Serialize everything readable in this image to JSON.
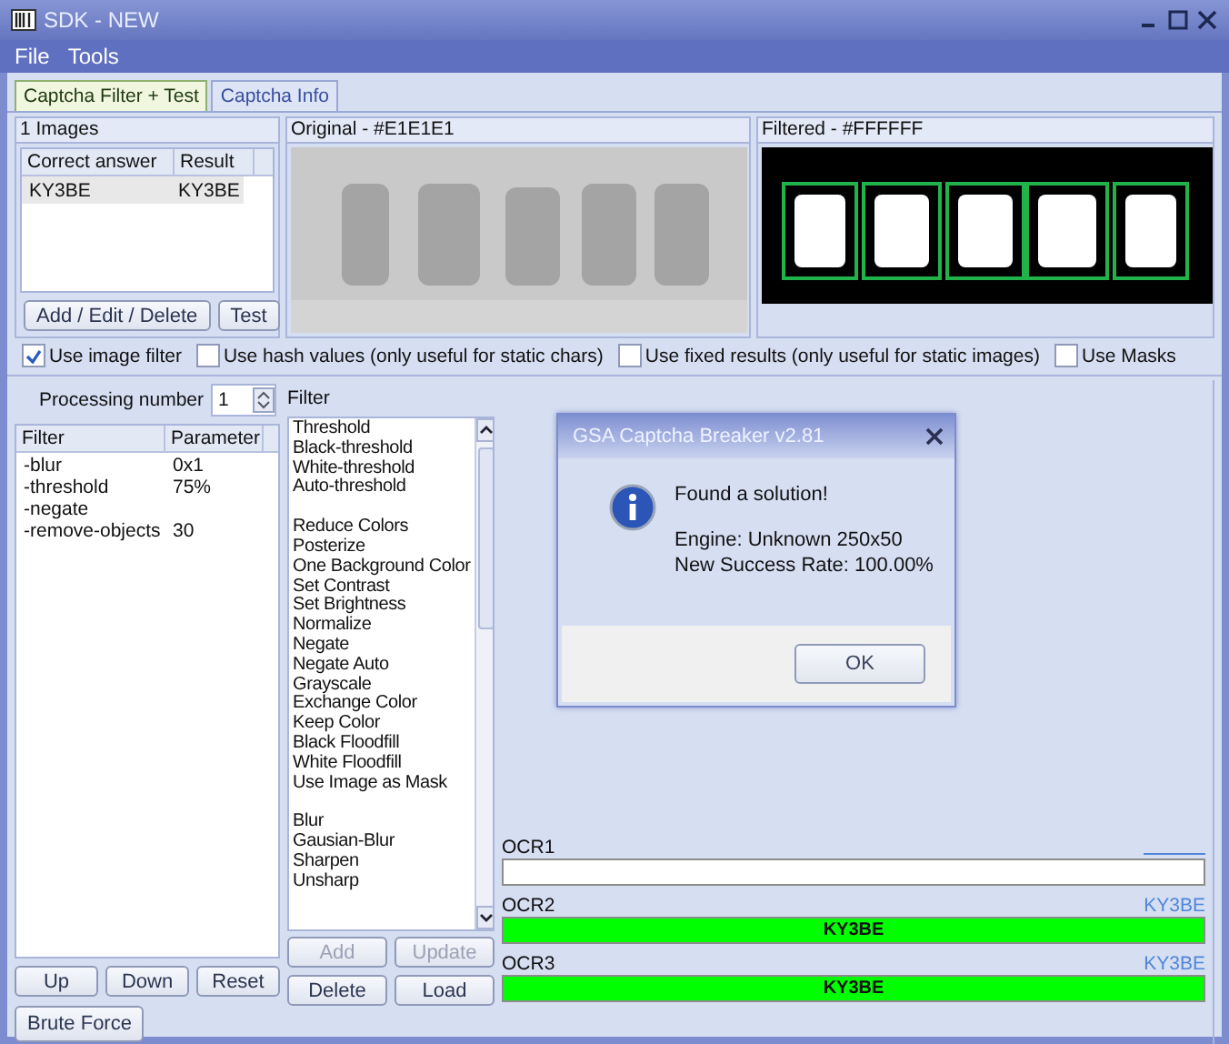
{
  "window": {
    "title": "SDK - NEW"
  },
  "menu": [
    "File",
    "Tools"
  ],
  "tabs": [
    {
      "label": "Captcha Filter + Test",
      "selected": true
    },
    {
      "label": "Captcha Info",
      "selected": false
    }
  ],
  "images_panel": {
    "title": "1 Images",
    "columns": [
      "Correct answer",
      "Result"
    ],
    "rows": [
      {
        "cells": [
          "KY3BE",
          "KY3BE"
        ],
        "selected": true
      }
    ],
    "buttons": [
      {
        "label": "Add / Edit / Delete",
        "disabled": false
      },
      {
        "label": "Test",
        "disabled": false
      }
    ]
  },
  "original": {
    "title": "Original - #E1E1E1"
  },
  "filtered": {
    "title": "Filtered - #FFFFFF"
  },
  "options": [
    {
      "label": "Use image filter",
      "checked": true
    },
    {
      "label": "Use hash values (only useful for static chars)",
      "checked": false
    },
    {
      "label": "Use fixed results (only useful for static images)",
      "checked": false
    },
    {
      "label": "Use Masks",
      "checked": false
    }
  ],
  "processing": {
    "label": "Processing number",
    "value": "1"
  },
  "filter_table": {
    "columns": [
      "Filter",
      "Parameter"
    ],
    "rows": [
      [
        "-blur",
        "0x1"
      ],
      [
        "-threshold",
        "75%"
      ],
      [
        "-negate"
      ],
      [
        "-remove-objects",
        "30"
      ]
    ]
  },
  "table_buttons": [
    {
      "label": "Up",
      "disabled": false
    },
    {
      "label": "Down",
      "disabled": false
    },
    {
      "label": "Reset",
      "disabled": false
    }
  ],
  "brute_force": "Brute Force",
  "filter_list": {
    "title": "Filter",
    "groups": [
      [
        "Threshold",
        "Black-threshold",
        "White-threshold",
        "Auto-threshold"
      ],
      [
        "Reduce Colors",
        "Posterize",
        "One Background Color",
        "Set Contrast",
        "Set Brightness",
        "Normalize",
        "Negate",
        "Negate Auto",
        "Grayscale",
        "Exchange Color",
        "Keep Color",
        "Black Floodfill",
        "White Floodfill",
        "Use Image as Mask"
      ],
      [
        "Blur",
        "Gausian-Blur",
        "Sharpen",
        "Unsharp"
      ]
    ]
  },
  "list_buttons": [
    {
      "label": "Add",
      "disabled": true
    },
    {
      "label": "Update",
      "disabled": true
    },
    {
      "label": "Delete",
      "disabled": false
    },
    {
      "label": "Load",
      "disabled": false
    }
  ],
  "dialog": {
    "title": "GSA Captcha Breaker v2.81",
    "heading": "Found a solution!",
    "lines": [
      "Engine: Unknown 250x50",
      "New Success Rate: 100.00%"
    ],
    "button": "OK"
  },
  "ocr": [
    {
      "label": "OCR1",
      "color": "#ffffff"
    },
    {
      "label": "OCR2",
      "result": "KY3BE",
      "value": "KY3BE",
      "color": "#00ff00"
    },
    {
      "label": "OCR3",
      "result": "KY3BE",
      "value": "KY3BE",
      "color": "#00ff00"
    }
  ]
}
